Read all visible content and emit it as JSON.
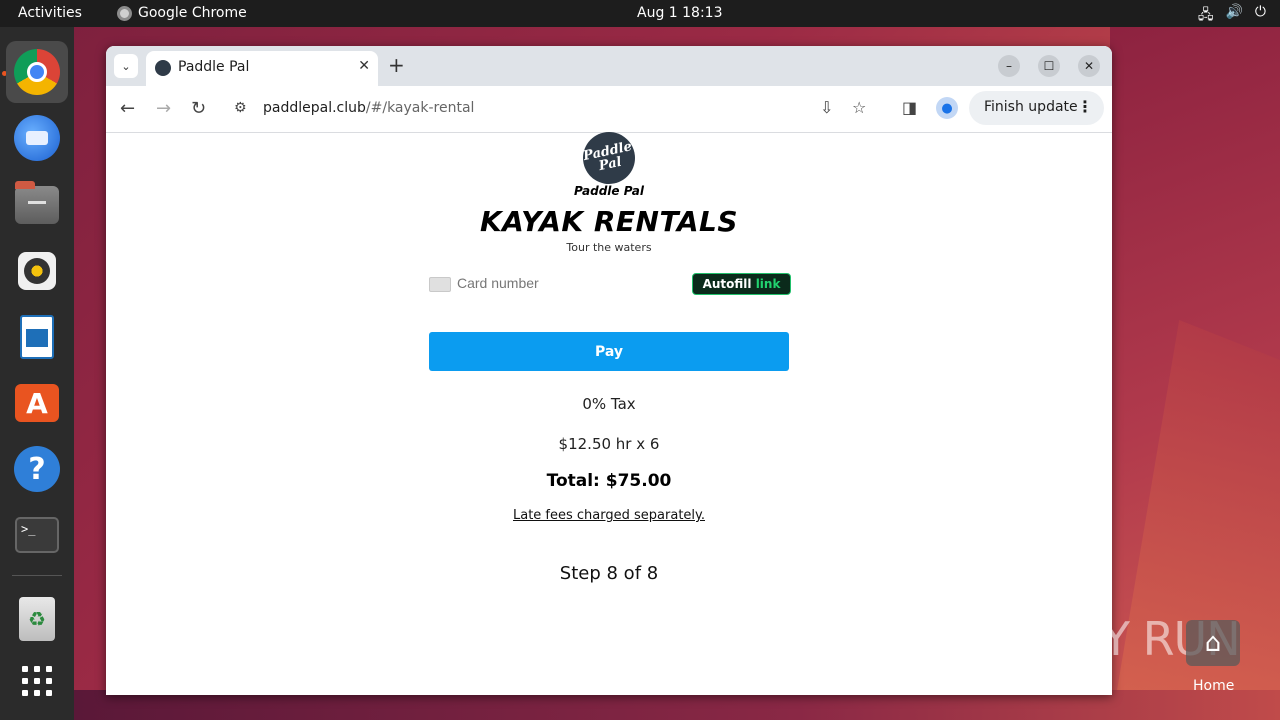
{
  "desktop": {
    "activities": "Activities",
    "active_app": "Google Chrome",
    "clock": "Aug 1  18:13",
    "home_label": "Home",
    "watermark": "ANY RUN"
  },
  "dock": {
    "items": [
      "Google Chrome",
      "Thunderbird",
      "Files",
      "Rhythmbox",
      "LibreOffice Writer",
      "Ubuntu Software",
      "Help",
      "Terminal",
      "Trash",
      "Show Applications"
    ]
  },
  "browser": {
    "tab_title": "Paddle Pal",
    "url_host": "paddlepal.club",
    "url_path": "/#/kayak-rental",
    "finish_update": "Finish update",
    "new_tab": "+"
  },
  "page": {
    "logo_text": "Paddle Pal",
    "logo_badge": "Paddle Pal",
    "headline": "KAYAK RENTALS",
    "tagline": "Tour the waters",
    "card_placeholder": "Card number",
    "autofill_label": "Autofill",
    "autofill_link": "link",
    "pay_label": "Pay",
    "tax": "0% Tax",
    "rate": "$12.50 hr x 6",
    "total": "Total: $75.00",
    "late_fees": "Late fees charged separately.",
    "step": "Step 8 of 8"
  },
  "colors": {
    "pay_button": "#0b9cf0",
    "autofill_bg": "#0b2a1b",
    "autofill_link": "#21d36f",
    "dock_bg": "#2b2b2b",
    "topbar_bg": "#1d1d1d"
  }
}
